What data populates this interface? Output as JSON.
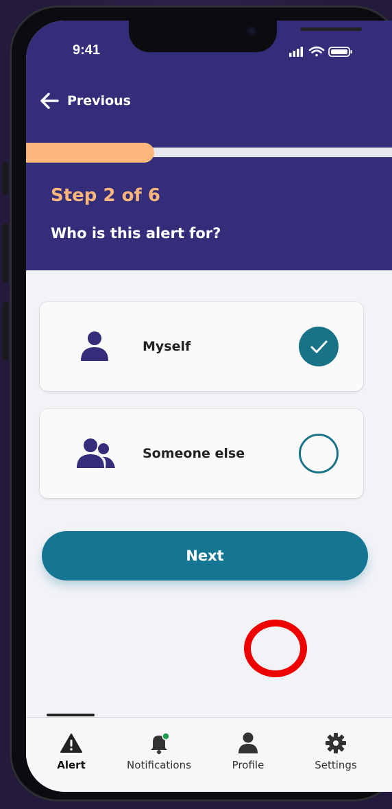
{
  "status_bar": {
    "time": "9:41"
  },
  "header": {
    "back_label": "Previous",
    "step_label": "Step 2 of 6",
    "progress": 0.33,
    "question": "Who is this alert for?"
  },
  "options": [
    {
      "label": "Myself",
      "icon": "person-icon",
      "selected": true
    },
    {
      "label": "Someone else",
      "icon": "people-icon",
      "selected": false
    }
  ],
  "next_button": {
    "label": "Next"
  },
  "tabbar": {
    "tabs": [
      {
        "label": "Alert",
        "icon": "warning-icon",
        "active": true
      },
      {
        "label": "Notifications",
        "icon": "bell-icon",
        "active": false
      },
      {
        "label": "Profile",
        "icon": "person-icon",
        "active": false
      },
      {
        "label": "Settings",
        "icon": "gear-icon",
        "active": false
      }
    ]
  },
  "colors": {
    "header_bg": "#332d7a",
    "accent_orange": "#fbb77b",
    "teal": "#197388",
    "next_button": "#157694",
    "screen_bg": "#f2f3f7"
  }
}
